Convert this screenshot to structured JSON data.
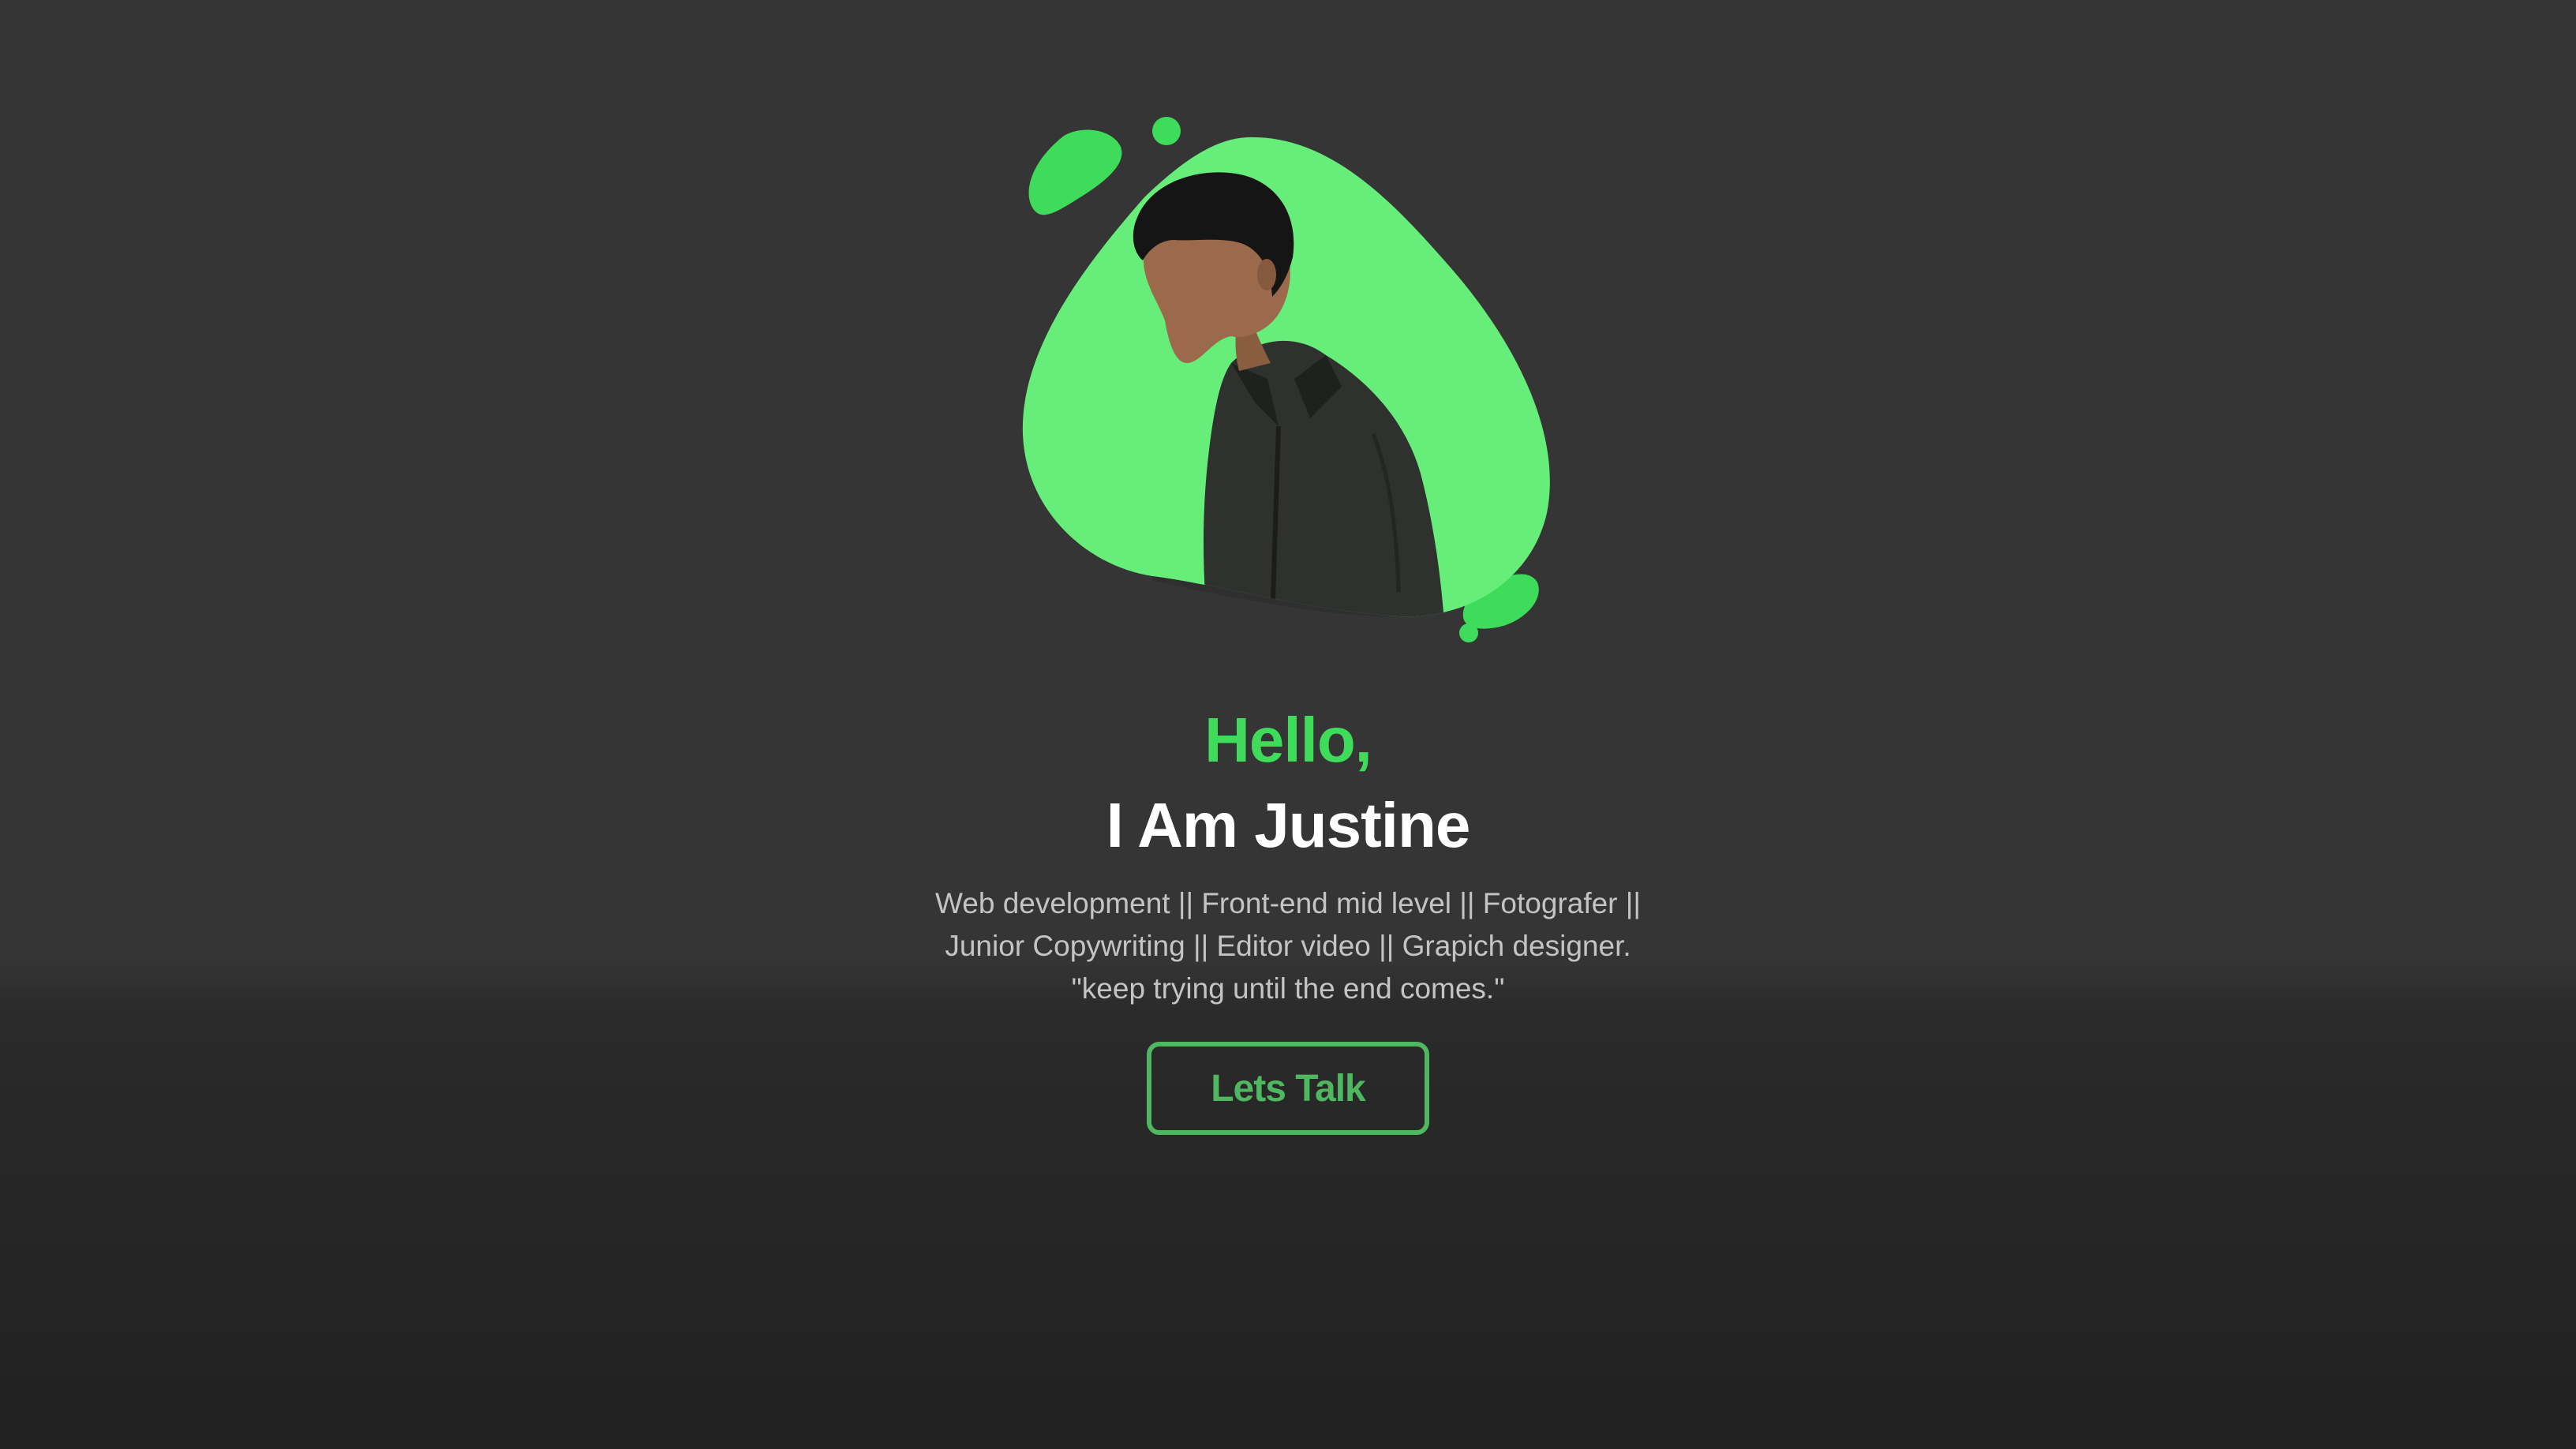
{
  "hero": {
    "greeting": "Hello,",
    "name": "I Am Justine",
    "roles_line1": "Web development || Front-end mid level || Fotografer ||",
    "roles_line2": "Junior Copywriting || Editor video || Grapich designer.",
    "motto": "\"keep trying until the end comes.\"",
    "cta_label": "Lets Talk",
    "portrait_alt": "Portrait of Justine"
  },
  "colors": {
    "background": "#353535",
    "accent": "#3fdc5b",
    "blob": "#67ee7a",
    "button": "#4fb760",
    "text_primary": "#ffffff",
    "text_secondary": "#c4c4c4"
  }
}
